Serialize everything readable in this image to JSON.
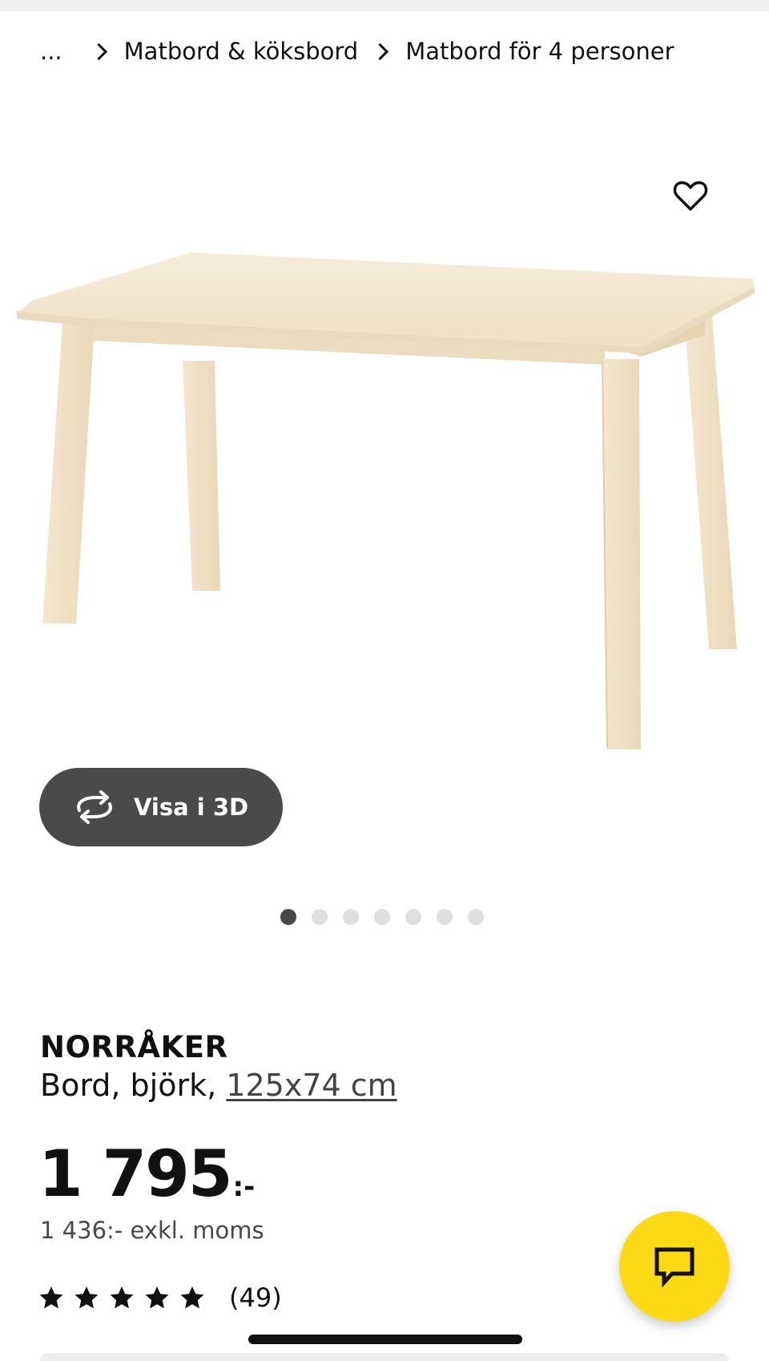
{
  "breadcrumb": {
    "ellipsis": "...",
    "items": [
      "Matbord & köksbord",
      "Matbord för 4 personer"
    ]
  },
  "gallery": {
    "favorite_icon": "heart-outline-icon",
    "view3d_label": "Visa i 3D",
    "view3d_icon": "rotate-arrows-icon",
    "dots_total": 7,
    "active_dot": 1
  },
  "product": {
    "name": "NORRÅKER",
    "description_prefix": "Bord, björk,",
    "size": "125x74 cm"
  },
  "price": {
    "amount": "1 795",
    "suffix": ":-",
    "excl_vat": "1 436:- exkl. moms"
  },
  "rating": {
    "stars": 5,
    "count": "(49)"
  },
  "chat": {
    "icon": "chat-bubble-icon"
  },
  "colors": {
    "accent_yellow": "#fbd914",
    "button_dark": "#4a4a4a",
    "wood": "#f3e6cf"
  }
}
